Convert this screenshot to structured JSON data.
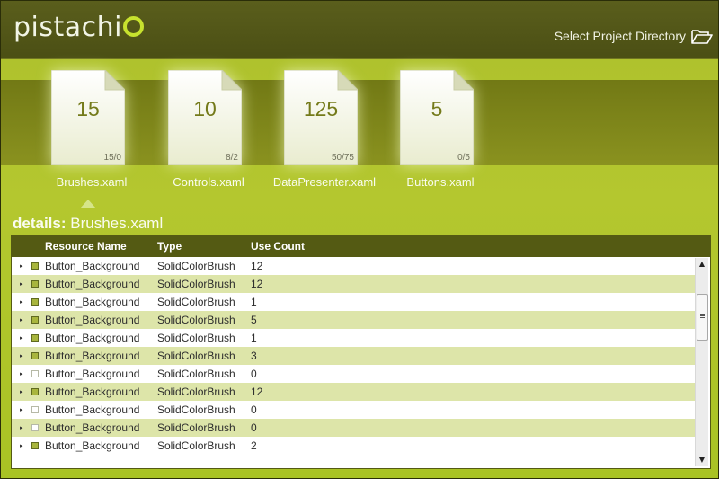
{
  "app": {
    "logo_text": "pistachi",
    "select_project_label": "Select Project Directory"
  },
  "files": [
    {
      "count": "15",
      "ratio": "15/0",
      "name": "Brushes.xaml"
    },
    {
      "count": "10",
      "ratio": "8/2",
      "name": "Controls.xaml"
    },
    {
      "count": "125",
      "ratio": "50/75",
      "name": "DataPresenter.xaml"
    },
    {
      "count": "5",
      "ratio": "0/5",
      "name": "Buttons.xaml"
    }
  ],
  "details": {
    "label": "details:",
    "file": "Brushes.xaml"
  },
  "grid": {
    "columns": [
      "Resource Name",
      "Type",
      "Use Count"
    ],
    "rows": [
      {
        "name": "Button_Background",
        "type": "SolidColorBrush",
        "count": "12",
        "marked": true
      },
      {
        "name": "Button_Background",
        "type": "SolidColorBrush",
        "count": "12",
        "marked": true
      },
      {
        "name": "Button_Background",
        "type": "SolidColorBrush",
        "count": "1",
        "marked": true
      },
      {
        "name": "Button_Background",
        "type": "SolidColorBrush",
        "count": "5",
        "marked": true
      },
      {
        "name": "Button_Background",
        "type": "SolidColorBrush",
        "count": "1",
        "marked": true
      },
      {
        "name": "Button_Background",
        "type": "SolidColorBrush",
        "count": "3",
        "marked": true
      },
      {
        "name": "Button_Background",
        "type": "SolidColorBrush",
        "count": "0",
        "marked": false
      },
      {
        "name": "Button_Background",
        "type": "SolidColorBrush",
        "count": "12",
        "marked": true
      },
      {
        "name": "Button_Background",
        "type": "SolidColorBrush",
        "count": "0",
        "marked": false
      },
      {
        "name": "Button_Background",
        "type": "SolidColorBrush",
        "count": "0",
        "marked": false
      },
      {
        "name": "Button_Background",
        "type": "SolidColorBrush",
        "count": "2",
        "marked": true
      }
    ]
  },
  "colors": {
    "accent": "#c7e22e",
    "header_bg": "#4b4f14",
    "grid_header_bg": "#545a13",
    "alt_row": "#dde5a9"
  },
  "icons": {
    "open_folder": "folder-open-icon",
    "document": "document-icon",
    "expander": "triangle-right-icon",
    "marker": "square-marker-icon"
  }
}
